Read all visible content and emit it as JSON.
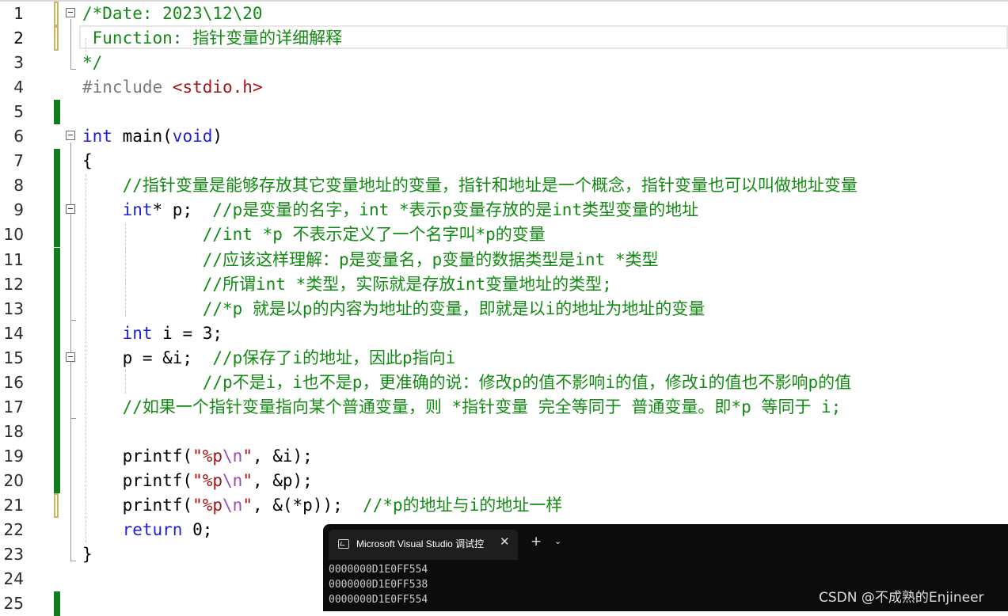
{
  "editor": {
    "lines": [
      {
        "n": "1",
        "segs": [
          {
            "t": "/*Date: 2023\\12\\20",
            "c": "cm"
          }
        ]
      },
      {
        "n": "2",
        "segs": [
          {
            "t": " Function: 指针变量的详细解释",
            "c": "cm"
          }
        ]
      },
      {
        "n": "3",
        "segs": [
          {
            "t": "*/",
            "c": "cm"
          }
        ]
      },
      {
        "n": "4",
        "segs": [
          {
            "t": "#include ",
            "c": "pp"
          },
          {
            "t": "<stdio.h>",
            "c": "str"
          }
        ]
      },
      {
        "n": "5",
        "segs": []
      },
      {
        "n": "6",
        "segs": [
          {
            "t": "int",
            "c": "kw"
          },
          {
            "t": " main(",
            "c": ""
          },
          {
            "t": "void",
            "c": "kw"
          },
          {
            "t": ")",
            "c": ""
          }
        ]
      },
      {
        "n": "7",
        "segs": [
          {
            "t": "{",
            "c": ""
          }
        ]
      },
      {
        "n": "8",
        "segs": [
          {
            "t": "    //指针变量是能够存放其它变量地址的变量，指针和地址是一个概念，指针变量也可以叫做地址变量",
            "c": "cm"
          }
        ]
      },
      {
        "n": "9",
        "segs": [
          {
            "t": "    ",
            "c": ""
          },
          {
            "t": "int",
            "c": "kw"
          },
          {
            "t": "* p;  ",
            "c": ""
          },
          {
            "t": "//p是变量的名字，int *表示p变量存放的是int类型变量的地址",
            "c": "cm"
          }
        ]
      },
      {
        "n": "10",
        "segs": [
          {
            "t": "            //int *p 不表示定义了一个名字叫*p的变量",
            "c": "cm"
          }
        ]
      },
      {
        "n": "11",
        "segs": [
          {
            "t": "            //应该这样理解：p是变量名，p变量的数据类型是int *类型",
            "c": "cm"
          }
        ]
      },
      {
        "n": "12",
        "segs": [
          {
            "t": "            //所谓int *类型，实际就是存放int变量地址的类型;",
            "c": "cm"
          }
        ]
      },
      {
        "n": "13",
        "segs": [
          {
            "t": "            //*p 就是以p的内容为地址的变量，即就是以i的地址为地址的变量",
            "c": "cm"
          }
        ]
      },
      {
        "n": "14",
        "segs": [
          {
            "t": "    ",
            "c": ""
          },
          {
            "t": "int",
            "c": "kw"
          },
          {
            "t": " i = 3;",
            "c": ""
          }
        ]
      },
      {
        "n": "15",
        "segs": [
          {
            "t": "    p = &i;  ",
            "c": ""
          },
          {
            "t": "//p保存了i的地址，因此p指向i",
            "c": "cm"
          }
        ]
      },
      {
        "n": "16",
        "segs": [
          {
            "t": "            //p不是i，i也不是p，更准确的说：修改p的值不影响i的值，修改i的值也不影响p的值",
            "c": "cm"
          }
        ]
      },
      {
        "n": "17",
        "segs": [
          {
            "t": "    //如果一个指针变量指向某个普通变量，则 *指针变量 完全等同于 普通变量。即*p 等同于 i;",
            "c": "cm"
          }
        ]
      },
      {
        "n": "18",
        "segs": []
      },
      {
        "n": "19",
        "segs": [
          {
            "t": "    printf(",
            "c": ""
          },
          {
            "t": "\"%p",
            "c": "str"
          },
          {
            "t": "\\n",
            "c": "esc"
          },
          {
            "t": "\"",
            "c": "str"
          },
          {
            "t": ", &i);",
            "c": ""
          }
        ]
      },
      {
        "n": "20",
        "segs": [
          {
            "t": "    printf(",
            "c": ""
          },
          {
            "t": "\"%p",
            "c": "str"
          },
          {
            "t": "\\n",
            "c": "esc"
          },
          {
            "t": "\"",
            "c": "str"
          },
          {
            "t": ", &p);",
            "c": ""
          }
        ]
      },
      {
        "n": "21",
        "segs": [
          {
            "t": "    printf(",
            "c": ""
          },
          {
            "t": "\"%p",
            "c": "str"
          },
          {
            "t": "\\n",
            "c": "esc"
          },
          {
            "t": "\"",
            "c": "str"
          },
          {
            "t": ", &(*p));  ",
            "c": ""
          },
          {
            "t": "//*p的地址与i的地址一样",
            "c": "cm"
          }
        ]
      },
      {
        "n": "22",
        "segs": [
          {
            "t": "    ",
            "c": ""
          },
          {
            "t": "return",
            "c": "kw"
          },
          {
            "t": " 0;",
            "c": ""
          }
        ]
      },
      {
        "n": "23",
        "segs": [
          {
            "t": "}",
            "c": ""
          }
        ]
      },
      {
        "n": "24",
        "segs": []
      },
      {
        "n": "25",
        "segs": []
      }
    ]
  },
  "terminal": {
    "tab_title": "Microsoft Visual Studio 调试控",
    "close_glyph": "✕",
    "new_tab_glyph": "+",
    "dropdown_glyph": "⌄",
    "output": [
      "0000000D1E0FF554",
      "0000000D1E0FF538",
      "0000000D1E0FF554"
    ]
  },
  "watermark": "CSDN @不成熟的Enjineer"
}
